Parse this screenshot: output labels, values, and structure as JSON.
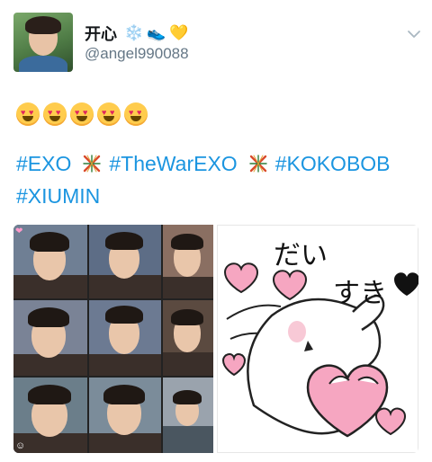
{
  "author": {
    "display_name": "开心",
    "badges": [
      "",
      "❄️",
      "👟",
      "💛"
    ],
    "handle": "@angel990088"
  },
  "tweet": {
    "emoji_line": [
      "😍",
      "😍",
      "😍",
      "😍",
      "😍"
    ],
    "hashtags": [
      "#EXO",
      "#TheWarEXO",
      "#KOKOBOB",
      "#XIUMIN"
    ]
  },
  "media": {
    "sticker_text_line1": "だい",
    "sticker_text_line2": "すき"
  },
  "colors": {
    "link": "#1b95e0",
    "muted": "#657786",
    "text": "#14171a",
    "sticker_pink": "#f6a6c1"
  },
  "icons": {
    "menu": "chevron-down-icon",
    "hashflag": "exo-hashflag-icon"
  }
}
